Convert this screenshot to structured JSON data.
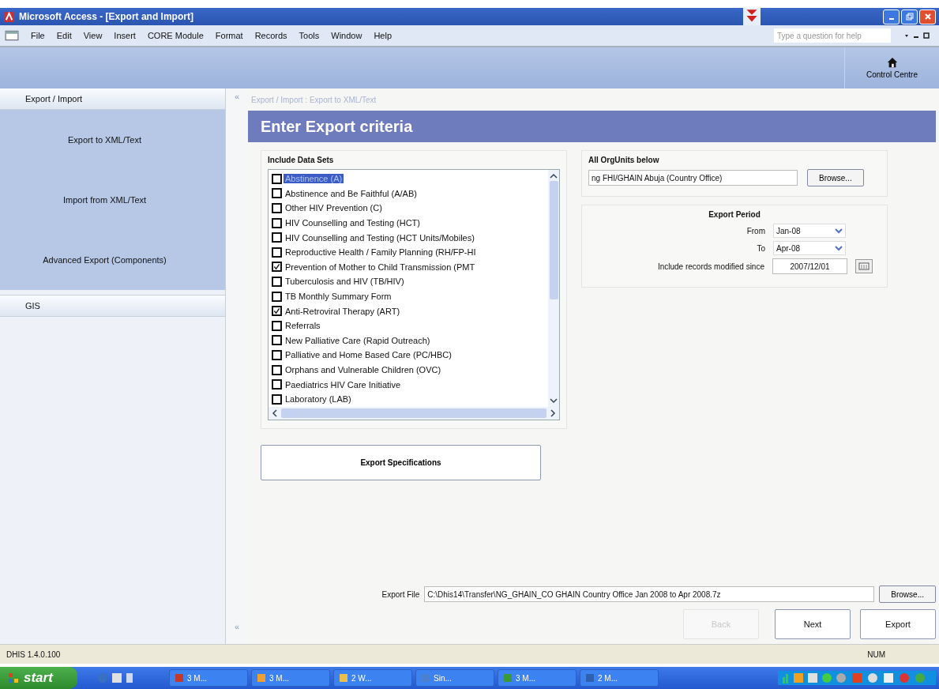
{
  "window": {
    "title": "Microsoft Access - [Export and Import]"
  },
  "menu": [
    "File",
    "Edit",
    "View",
    "Insert",
    "CORE Module",
    "Format",
    "Records",
    "Tools",
    "Window",
    "Help"
  ],
  "help_box": {
    "placeholder": "Type a question for help"
  },
  "toolbar": {
    "control_centre": "Control Centre"
  },
  "sidebar": {
    "sections": [
      {
        "title": "Export / Import",
        "expanded": true,
        "items": [
          "Export to XML/Text",
          "Import from XML/Text",
          "Advanced Export (Components)"
        ]
      },
      {
        "title": "GIS",
        "expanded": false
      }
    ]
  },
  "gutter": {
    "top": "«",
    "bottom": "«"
  },
  "breadcrumb": "Export / Import : Export to XML/Text",
  "heading": "Enter Export criteria",
  "data_sets": {
    "title": "Include Data Sets",
    "items": [
      {
        "label": "Abstinence (A)",
        "checked": false,
        "selected": true
      },
      {
        "label": "Abstinence and Be Faithful (A/AB)",
        "checked": false,
        "selected": false
      },
      {
        "label": "Other HIV Prevention (C)",
        "checked": false,
        "selected": false
      },
      {
        "label": "HIV Counselling and Testing (HCT)",
        "checked": false,
        "selected": false
      },
      {
        "label": "HIV Counselling and Testing (HCT Units/Mobiles)",
        "checked": false,
        "selected": false
      },
      {
        "label": "Reproductive Health / Family Planning (RH/FP-HI",
        "checked": false,
        "selected": false
      },
      {
        "label": "Prevention of Mother to Child Transmission (PMT",
        "checked": true,
        "selected": false
      },
      {
        "label": "Tuberculosis and HIV (TB/HIV)",
        "checked": false,
        "selected": false
      },
      {
        "label": "TB Monthly Summary Form",
        "checked": false,
        "selected": false
      },
      {
        "label": "Anti-Retroviral Therapy (ART)",
        "checked": true,
        "selected": false
      },
      {
        "label": "Referrals",
        "checked": false,
        "selected": false
      },
      {
        "label": "New Palliative Care (Rapid Outreach)",
        "checked": false,
        "selected": false
      },
      {
        "label": "Palliative and Home Based Care (PC/HBC)",
        "checked": false,
        "selected": false
      },
      {
        "label": "Orphans and Vulnerable Children (OVC)",
        "checked": false,
        "selected": false
      },
      {
        "label": "Paediatrics HIV Care Initiative",
        "checked": false,
        "selected": false
      },
      {
        "label": "Laboratory (LAB)",
        "checked": false,
        "selected": false
      }
    ]
  },
  "export_specifications": "Export Specifications",
  "org_units": {
    "title": "All OrgUnits below",
    "value": "ng FHI/GHAIN Abuja (Country Office)",
    "browse": "Browse..."
  },
  "export_period": {
    "title": "Export Period",
    "from_label": "From",
    "from": "Jan-08",
    "to_label": "To",
    "to": "Apr-08",
    "since_label": "Include records modified since",
    "since": "2007/12/01"
  },
  "export_file": {
    "label": "Export File",
    "value": "C:\\Dhis14\\Transfer\\NG_GHAIN_CO GHAIN Country Office Jan 2008 to Apr 2008.7z",
    "browse": "Browse..."
  },
  "buttons": [
    {
      "label": "Back",
      "disabled": true
    },
    {
      "label": "Next",
      "disabled": false
    },
    {
      "label": "Export",
      "disabled": false
    }
  ],
  "status_bar": {
    "version": "DHIS 1.4.0.100",
    "indicator": "NUM"
  },
  "taskbar": {
    "start": "start",
    "tasks": [
      "3 M...",
      "3 M...",
      "2 W...",
      "Sin...",
      "3 M...",
      "2 M..."
    ]
  }
}
